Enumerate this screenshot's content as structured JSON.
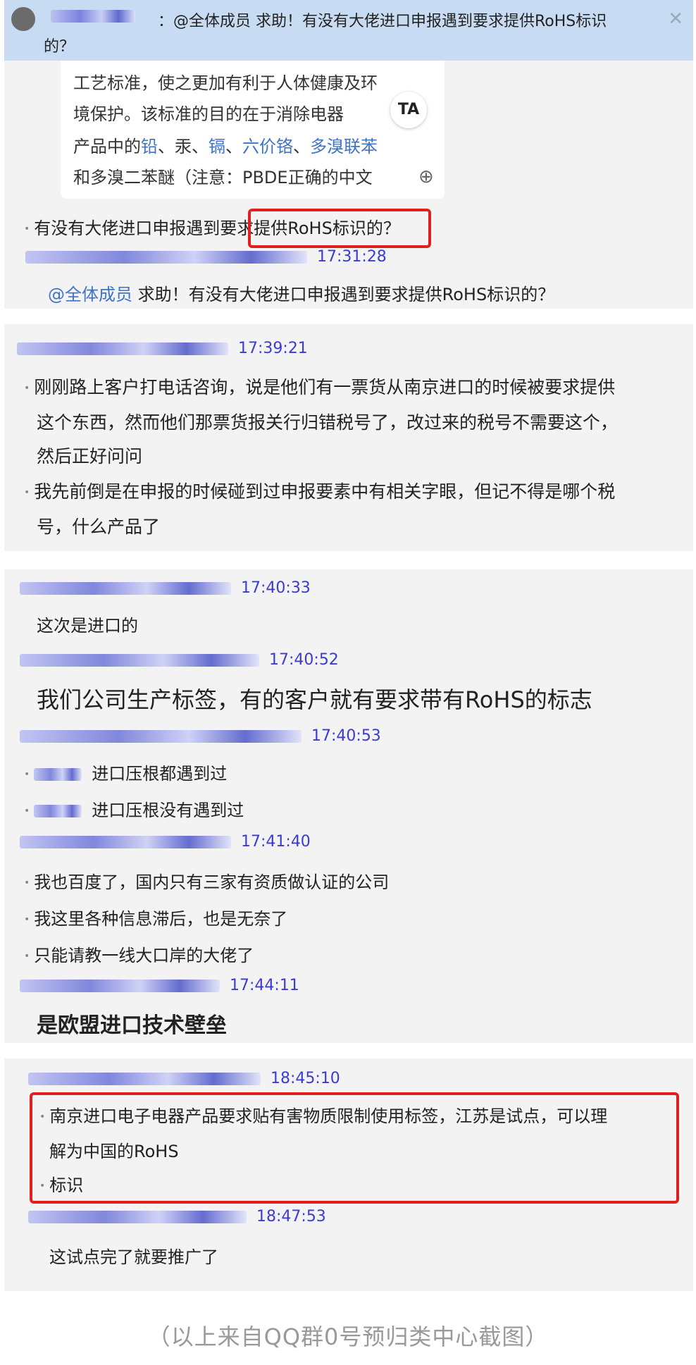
{
  "notice": {
    "text_line1": "：@全体成员 求助！有没有大佬进口申报遇到要求提供RoHS标识",
    "text_line2": "的？"
  },
  "panel1": {
    "excerpt_lines": [
      "工艺标准，使之更加有利于人体健康及环",
      "境保护。该标准的目的在于消除电器",
      "产品中的",
      "和多溴二苯醚（注意：PBDE正确的中文"
    ],
    "excerpt_tokens": [
      "铅",
      "、汞、",
      "镉",
      "、",
      "六价铬",
      "、",
      "多溴联苯"
    ],
    "ta_label": "TA",
    "question": "有没有大佬进口申报遇到要求提供RoHS标识的？",
    "time1": "17:31:28",
    "mention": "@全体成员",
    "mention_text": " 求助！有没有大佬进口申报遇到要求提供RoHS标识的？"
  },
  "panel2": {
    "time": "17:39:21",
    "msg1_l1": "刚刚路上客户打电话咨询，说是他们有一票货从南京进口的时候被要求提供",
    "msg1_l2": "这个东西，然而他们那票货报关行归错税号了，改过来的税号不需要这个，",
    "msg1_l3": "然后正好问问",
    "msg2_l1": "我先前倒是在申报的时候碰到过申报要素中有相关字眼，但记不得是哪个税",
    "msg2_l2": "号，什么产品了"
  },
  "panel3": {
    "t1": "17:40:33",
    "m1": "这次是进口的",
    "t2": "17:40:52",
    "m2": "我们公司生产标签，有的客户就有要求带有RoHS的标志",
    "t3": "17:40:53",
    "m3a": "进口压根都遇到过",
    "m3b": "进口压根没有遇到过",
    "t4": "17:41:40",
    "m4a": "我也百度了，国内只有三家有资质做认证的公司",
    "m4b": "我这里各种信息滞后，也是无奈了",
    "m4c": "只能请教一线大口岸的大佬了",
    "t5": "17:44:11",
    "m5": "是欧盟进口技术壁垒"
  },
  "panel4": {
    "t1": "18:45:10",
    "m1_l1": "南京进口电子电器产品要求贴有害物质限制使用标签，江苏是试点，可以理",
    "m1_l2": "解为中国的RoHS",
    "m1_l3": "标识",
    "t2": "18:47:53",
    "m2": "这试点完了就要推广了"
  },
  "caption": "（以上来自QQ群0号预归类中心截图）",
  "colors": {
    "timestamp": "#3b3bd1",
    "highlight_box": "#e02020",
    "link": "#3d73c9",
    "notice_bg": "#c7dcf2"
  }
}
